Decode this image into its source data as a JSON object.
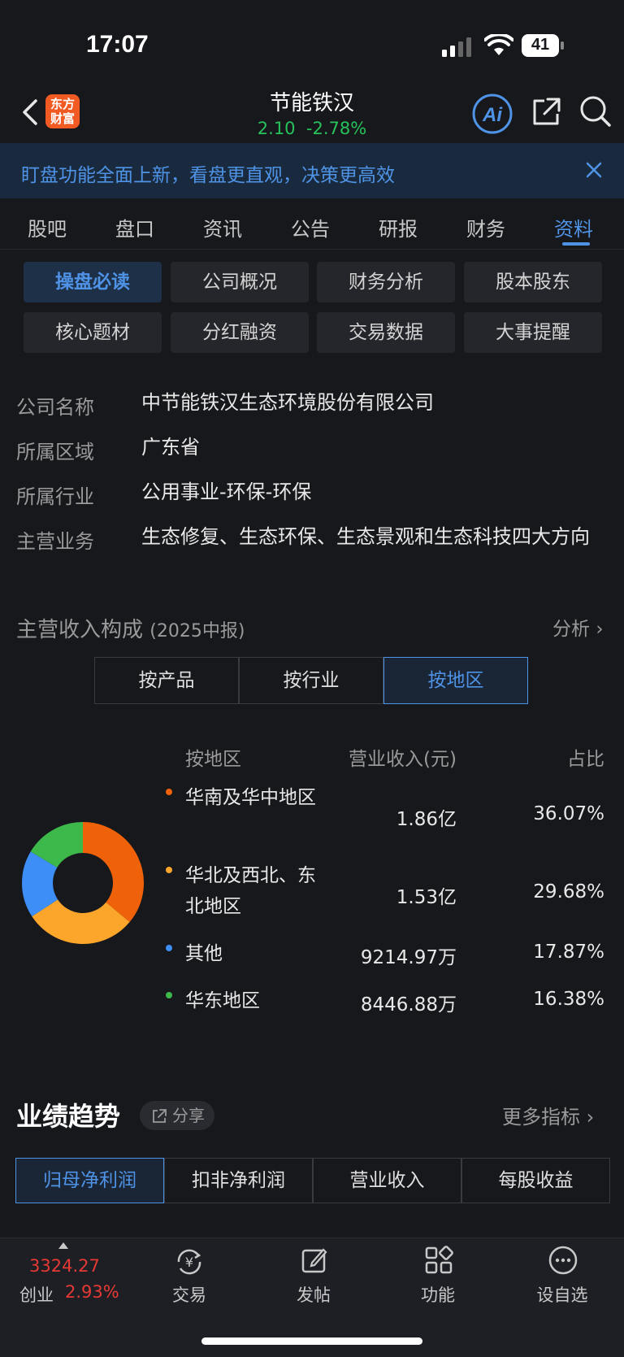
{
  "status": {
    "time": "17:07",
    "battery": "41"
  },
  "header": {
    "logo": [
      "东方",
      "财富"
    ],
    "stock_name": "节能铁汉",
    "price": "2.10",
    "change": "-2.78%"
  },
  "banner": {
    "text": "盯盘功能全面上新，看盘更直观，决策更高效"
  },
  "tabs": [
    "股吧",
    "盘口",
    "资讯",
    "公告",
    "研报",
    "财务",
    "资料"
  ],
  "chips": [
    "操盘必读",
    "公司概况",
    "财务分析",
    "股本股东",
    "核心题材",
    "分红融资",
    "交易数据",
    "大事提醒"
  ],
  "info": [
    {
      "label": "公司名称",
      "value": "中节能铁汉生态环境股份有限公司"
    },
    {
      "label": "所属区域",
      "value": "广东省"
    },
    {
      "label": "所属行业",
      "value": "公用事业-环保-环保"
    },
    {
      "label": "主营业务",
      "value": "生态修复、生态环保、生态景观和生态科技四大方向"
    }
  ],
  "revenue": {
    "title": "主营收入构成",
    "period": "(2025中报)",
    "analyze": "分析",
    "segments": [
      "按产品",
      "按行业",
      "按地区"
    ],
    "headers": [
      "按地区",
      "营业收入(元)",
      "占比"
    ]
  },
  "chart_data": {
    "type": "pie",
    "donut": true,
    "categories": [
      "华南及华中地区",
      "华北及西北、东北地区",
      "其他",
      "华东地区"
    ],
    "revenue_labels": [
      "1.86亿",
      "1.53亿",
      "9214.97万",
      "8446.88万"
    ],
    "pct_labels": [
      "36.07%",
      "29.68%",
      "17.87%",
      "16.38%"
    ],
    "values": [
      36.07,
      29.68,
      17.87,
      16.38
    ],
    "colors": [
      "#f0620a",
      "#fba52a",
      "#3d8ef7",
      "#3db84a"
    ]
  },
  "performance": {
    "title": "业绩趋势",
    "share": "分享",
    "more": "更多指标",
    "tabs": [
      "归母净利润",
      "扣非净利润",
      "营业收入",
      "每股收益"
    ]
  },
  "bottom_nav": {
    "index_value": "3324.27",
    "index_name": "创业",
    "index_pct": "2.93%",
    "items": [
      "交易",
      "发帖",
      "功能",
      "设自选"
    ]
  }
}
